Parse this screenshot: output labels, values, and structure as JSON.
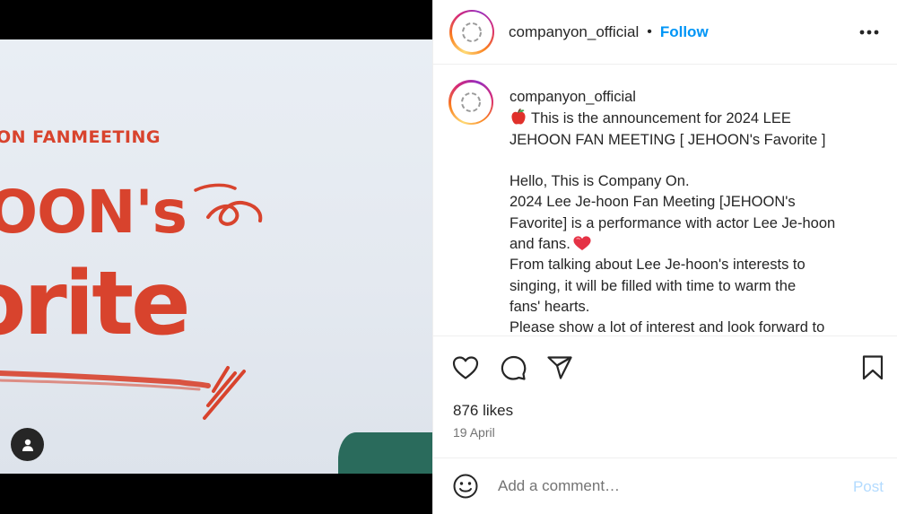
{
  "poster": {
    "subtitle": "ON FANMEETING",
    "title_line1": "OON's",
    "title_line2": "orite",
    "text_color": "#d8432d"
  },
  "header": {
    "username": "companyon_official",
    "separator": "•",
    "follow_label": "Follow",
    "icons": {
      "avatar": "avatar-icon",
      "more": "more-options-icon"
    }
  },
  "caption": {
    "username": "companyon_official",
    "lines": [
      "This is the announcement for 2024 LEE",
      "JEHOON FAN MEETING [ JEHOON's Favorite ]",
      "",
      "Hello, This is Company On.",
      "2024 Lee Je-hoon Fan Meeting [JEHOON's",
      "Favorite] is a performance with actor Lee Je-hoon",
      "and fans.",
      "From talking about Lee Je-hoon's interests to",
      "singing, it will be filled with time to warm the",
      "fans' hearts.",
      "Please show a lot of interest and look forward to"
    ],
    "icons": {
      "first_line": "apple-emoji",
      "fans_line": "heart-emoji"
    }
  },
  "actions": {
    "icons": [
      "heart-icon",
      "comment-icon",
      "share-icon",
      "bookmark-icon"
    ]
  },
  "stats": {
    "likes": "876 likes",
    "date": "19 April"
  },
  "comment": {
    "placeholder": "Add a comment…",
    "post_label": "Post",
    "icons": {
      "emoji": "smiley-icon"
    }
  },
  "colors": {
    "follow": "#0095f6",
    "post_disabled": "#b3dbff",
    "secondary_text": "#737373",
    "text": "#262626"
  }
}
